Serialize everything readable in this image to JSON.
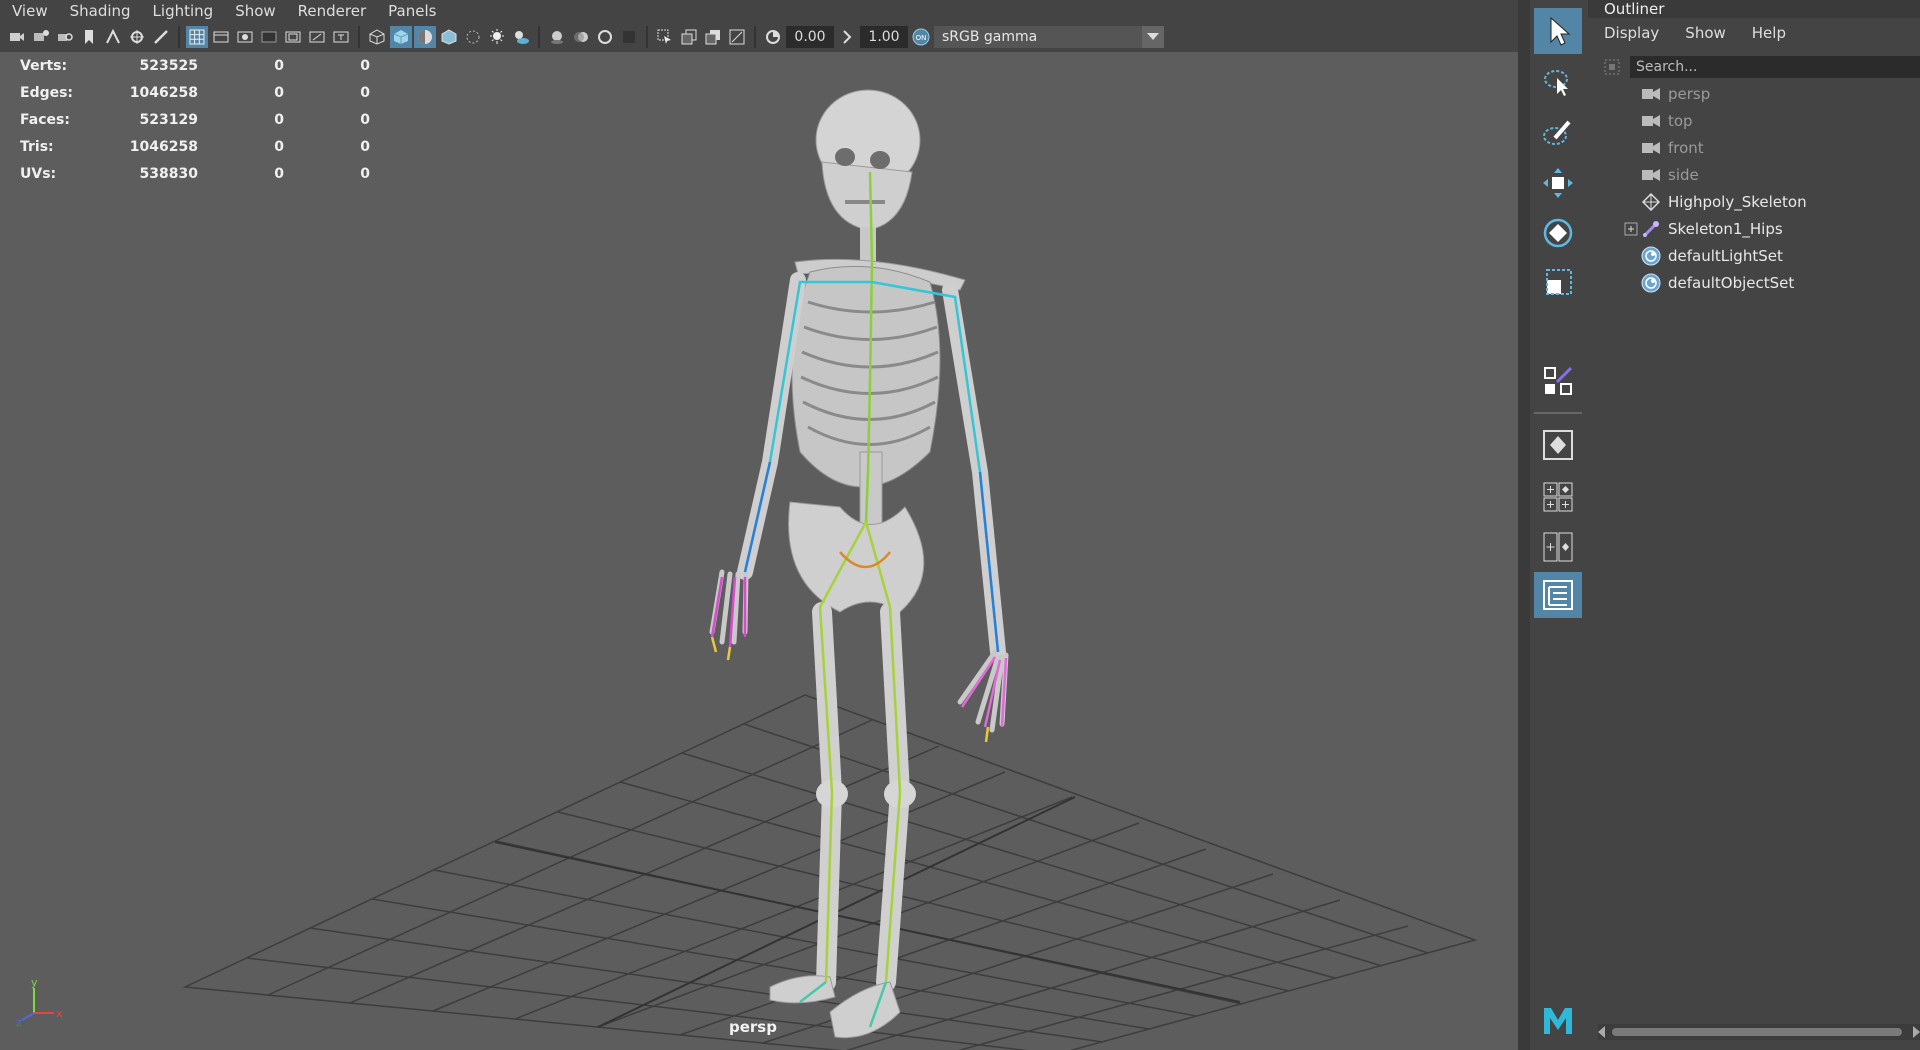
{
  "viewport": {
    "menu": [
      "View",
      "Shading",
      "Lighting",
      "Show",
      "Renderer",
      "Panels"
    ],
    "toolbar": {
      "exposure": "0.00",
      "gamma": "1.00",
      "colorspace": "sRGB gamma",
      "icons": [
        "camera-select-icon",
        "camera-attributes-icon",
        "bookmarks-icon",
        "image-plane-icon",
        "2d-pan-zoom-icon",
        "grease-pencil-icon",
        "grid-icon",
        "film-gate-icon",
        "resolution-gate-icon",
        "gate-mask-icon",
        "field-chart-icon",
        "safe-action-icon",
        "safe-title-icon",
        "wireframe-icon",
        "smooth-shade-icon",
        "default-material-icon",
        "wireframe-on-shaded-icon",
        "xray-icon",
        "use-all-lights-icon",
        "shadows-icon",
        "ambient-occlusion-icon",
        "motion-blur-icon",
        "multisample-aa-icon",
        "depth-of-field-icon",
        "isolate-select-icon",
        "xray-joints-icon",
        "xray-active-icon",
        "backface-culling-icon",
        "exposure-icon",
        "gamma-icon",
        "color-management-icon"
      ]
    },
    "hud": [
      {
        "label": "Verts:",
        "v1": "523525",
        "v2": "0",
        "v3": "0"
      },
      {
        "label": "Edges:",
        "v1": "1046258",
        "v2": "0",
        "v3": "0"
      },
      {
        "label": "Faces:",
        "v1": "523129",
        "v2": "0",
        "v3": "0"
      },
      {
        "label": "Tris:",
        "v1": "1046258",
        "v2": "0",
        "v3": "0"
      },
      {
        "label": "UVs:",
        "v1": "538830",
        "v2": "0",
        "v3": "0"
      }
    ],
    "camera_label": "persp",
    "axis": {
      "y": "y",
      "x": "x",
      "z": "z"
    }
  },
  "toolbox": {
    "tools": [
      "select-tool-icon",
      "lasso-tool-icon",
      "paint-select-icon",
      "move-tool-icon",
      "rotate-tool-icon",
      "scale-tool-icon",
      "last-tool-icon",
      "single-perspective-layout-icon",
      "four-view-layout-icon",
      "two-pane-layout-icon",
      "outliner-layout-icon"
    ]
  },
  "outliner": {
    "title": "Outliner",
    "menu": [
      "Display",
      "Show",
      "Help"
    ],
    "search_placeholder": "Search...",
    "items": [
      {
        "label": "persp",
        "icon": "camera-icon"
      },
      {
        "label": "top",
        "icon": "camera-icon"
      },
      {
        "label": "front",
        "icon": "camera-icon"
      },
      {
        "label": "side",
        "icon": "camera-icon"
      },
      {
        "label": "Highpoly_Skeleton",
        "icon": "mesh-icon"
      },
      {
        "label": "Skeleton1_Hips",
        "icon": "joint-icon"
      },
      {
        "label": "defaultLightSet",
        "icon": "set-icon"
      },
      {
        "label": "defaultObjectSet",
        "icon": "set-icon"
      }
    ]
  },
  "colors": {
    "viewport_bg": "#5d5d5d",
    "panel_bg": "#444444",
    "active_tool": "#5285a6",
    "joint_cyan": "#35c6d6",
    "joint_green": "#8ccf3a"
  }
}
